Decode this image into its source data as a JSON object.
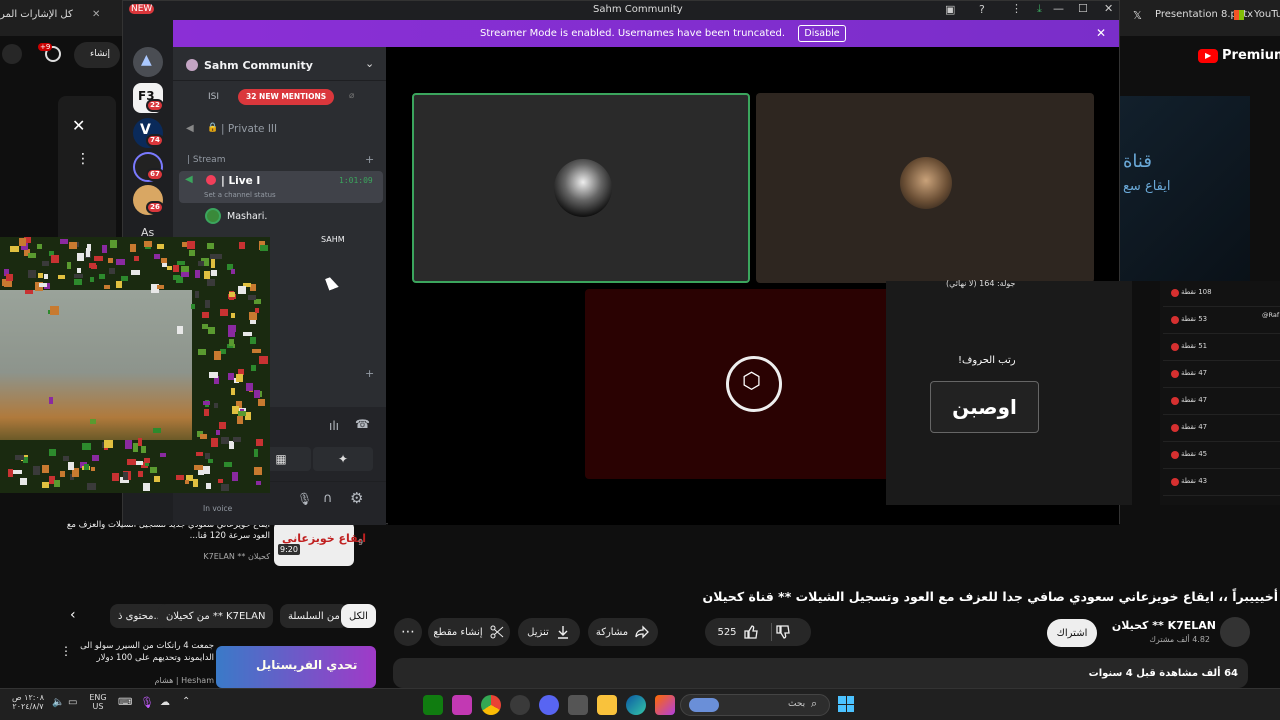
{
  "browser": {
    "tabs": [
      {
        "label": "كل الإشارات المر"
      },
      {
        "label": "Presentation 8.pptx"
      },
      {
        "label": "YouTu"
      }
    ],
    "premium_label": "Premium"
  },
  "discord": {
    "window_title": "Sahm Community",
    "banner": {
      "text": "Streamer Mode is enabled. Usernames have been truncated.",
      "button": "Disable"
    },
    "new_badge": "NEW",
    "guild_badges": [
      "22",
      "74",
      "67",
      "26"
    ],
    "guild_labels": [
      "F3",
      "As"
    ],
    "server_name": "Sahm Community",
    "mentions_pill": "32 NEW MENTIONS",
    "channel_partial": "ISI",
    "private_channel": "| Private III",
    "category": "| Stream",
    "live_channel": "| Live I",
    "live_timer": "1:01:09",
    "channel_status": "Set a channel status",
    "member_1": "Mashari.",
    "member_2": "SAHM",
    "user_status": "In voice"
  },
  "game": {
    "round_text": "جولة: 164 (لا نهائي)",
    "prompt": "رتب الحروف!",
    "word": "اوصبن",
    "scores": [
      "108 نقطة",
      "53 نقطة",
      "51 نقطة",
      "47 نقطة",
      "47 نقطة",
      "47 نقطة",
      "45 نقطة",
      "43 نقطة"
    ],
    "right_handle": "@Raf"
  },
  "youtube": {
    "video_title": "أخيييبراً ،، ايقاع خويزعاني سعودي صافي جدا للعزف مع العود وتسجيل الشيلات ** قناة كحيلان",
    "channel_name": "كحيلان ** K7ELAN",
    "subscribers": "4.82 ألف مشترك",
    "subscribe_label": "اشتراك",
    "likes": "525",
    "share_label": "مشاركة",
    "download_label": "تنزيل",
    "clip_label": "إنشاء مقطع",
    "views_text": "64 ألف مشاهدة  قبل 4 سنوات",
    "chips": [
      "الكل",
      "من السلسلة",
      "من كحيلان ** K7ELAN",
      "محتوى ذ..."
    ],
    "related": [
      {
        "title": "ايقاع خويزعاني سعودي جديد لتسجيل الشيلات والعزف مع العود سرعة 120 قنا...",
        "channel": "كحيلان ** K7ELAN",
        "duration": "9:20",
        "thumb_text": "ايقاع خويزعاني",
        "index": "9"
      },
      {
        "title": "جمعت 4 رانكات من السيرر سولو الى الدايموند وتحديهم على 100 دولار",
        "channel": "Hesham | هشام",
        "thumb_text": "تحدي الفريستايل"
      }
    ],
    "hero_text_1": "قناة",
    "hero_text_2": "ايقاع سع",
    "top_left_badge": "+9",
    "top_left_label": "إنشاء"
  },
  "taskbar": {
    "time": "١٢:٠٨ ص",
    "date": "٢٠٢٤/٨/٧",
    "lang_1": "ENG",
    "lang_2": "US",
    "search_placeholder": "بحث"
  }
}
